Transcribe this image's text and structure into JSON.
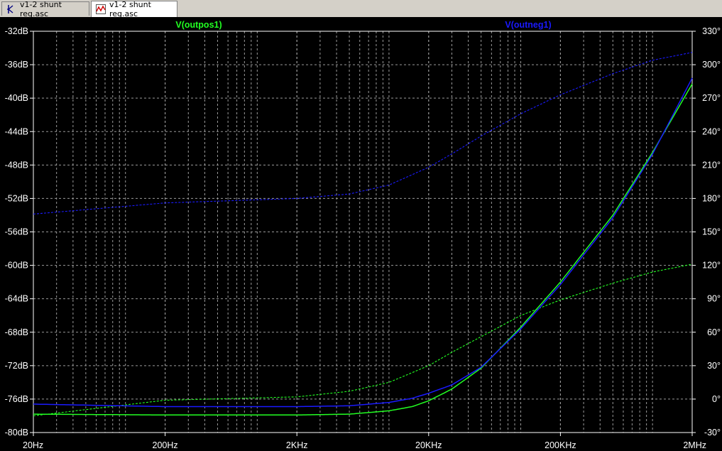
{
  "tabs": [
    {
      "label": "v1-2 shunt reg.asc",
      "icon": "schematic-icon",
      "active": false
    },
    {
      "label": "v1-2 shunt reg.asc",
      "icon": "waveform-icon",
      "active": true
    }
  ],
  "colors": {
    "background": "#000000",
    "grid": "#9a9a9a",
    "axis_text": "#ffffff",
    "series_green": "#22ff22",
    "series_blue": "#1a1aff"
  },
  "chart_data": {
    "type": "line",
    "x_scale": "log",
    "xlim": [
      20,
      2000000
    ],
    "x_ticks": [
      {
        "value": 20,
        "label": "20Hz"
      },
      {
        "value": 200,
        "label": "200Hz"
      },
      {
        "value": 2000,
        "label": "2KHz"
      },
      {
        "value": 20000,
        "label": "20KHz"
      },
      {
        "value": 200000,
        "label": "200KHz"
      },
      {
        "value": 2000000,
        "label": "2MHz"
      }
    ],
    "y_left": {
      "unit": "dB",
      "ylim": [
        -80,
        -32
      ],
      "ticks": [
        {
          "value": -32,
          "label": "-32dB"
        },
        {
          "value": -36,
          "label": "-36dB"
        },
        {
          "value": -40,
          "label": "-40dB"
        },
        {
          "value": -44,
          "label": "-44dB"
        },
        {
          "value": -48,
          "label": "-48dB"
        },
        {
          "value": -52,
          "label": "-52dB"
        },
        {
          "value": -56,
          "label": "-56dB"
        },
        {
          "value": -60,
          "label": "-60dB"
        },
        {
          "value": -64,
          "label": "-64dB"
        },
        {
          "value": -68,
          "label": "-68dB"
        },
        {
          "value": -72,
          "label": "-72dB"
        },
        {
          "value": -76,
          "label": "-76dB"
        },
        {
          "value": -80,
          "label": "-80dB"
        }
      ]
    },
    "y_right": {
      "unit": "°",
      "ylim": [
        -30,
        330
      ],
      "ticks": [
        {
          "value": 330,
          "label": "330°"
        },
        {
          "value": 300,
          "label": "300°"
        },
        {
          "value": 270,
          "label": "270°"
        },
        {
          "value": 240,
          "label": "240°"
        },
        {
          "value": 210,
          "label": "210°"
        },
        {
          "value": 180,
          "label": "180°"
        },
        {
          "value": 150,
          "label": "150°"
        },
        {
          "value": 120,
          "label": "120°"
        },
        {
          "value": 90,
          "label": "90°"
        },
        {
          "value": 60,
          "label": "60°"
        },
        {
          "value": 30,
          "label": "30°"
        },
        {
          "value": 0,
          "label": "0°"
        },
        {
          "value": -30,
          "label": "-30°"
        }
      ]
    },
    "grid": true,
    "series": [
      {
        "name": "V(outpos1)",
        "color": "#22ff22",
        "magnitude": {
          "x": [
            20,
            200,
            2000,
            5000,
            10000,
            15000,
            20000,
            30000,
            50000,
            100000,
            200000,
            500000,
            1000000,
            2000000
          ],
          "y": [
            -77.8,
            -77.9,
            -77.9,
            -77.8,
            -77.4,
            -76.9,
            -76.2,
            -74.8,
            -72.3,
            -67.4,
            -62.0,
            -54.0,
            -46.5,
            -38.3
          ]
        },
        "phase": {
          "x": [
            20,
            200,
            2000,
            5000,
            10000,
            20000,
            30000,
            50000,
            100000,
            200000,
            500000,
            1000000,
            2000000
          ],
          "y": [
            -15,
            -1,
            2,
            7,
            15,
            30,
            42,
            56,
            75,
            89,
            104,
            114,
            121
          ]
        }
      },
      {
        "name": "V(outneg1)",
        "color": "#1a1aff",
        "magnitude": {
          "x": [
            20,
            200,
            2000,
            5000,
            10000,
            15000,
            20000,
            30000,
            50000,
            100000,
            200000,
            500000,
            1000000,
            2000000
          ],
          "y": [
            -76.6,
            -76.9,
            -76.9,
            -76.8,
            -76.4,
            -75.9,
            -75.3,
            -74.3,
            -72.2,
            -67.6,
            -62.3,
            -54.3,
            -46.7,
            -37.6
          ]
        },
        "phase": {
          "x": [
            20,
            200,
            2000,
            5000,
            10000,
            20000,
            30000,
            50000,
            100000,
            200000,
            500000,
            1000000,
            2000000
          ],
          "y": [
            166,
            176,
            180,
            184,
            192,
            208,
            220,
            236,
            256,
            273,
            292,
            304,
            311
          ]
        }
      }
    ]
  }
}
